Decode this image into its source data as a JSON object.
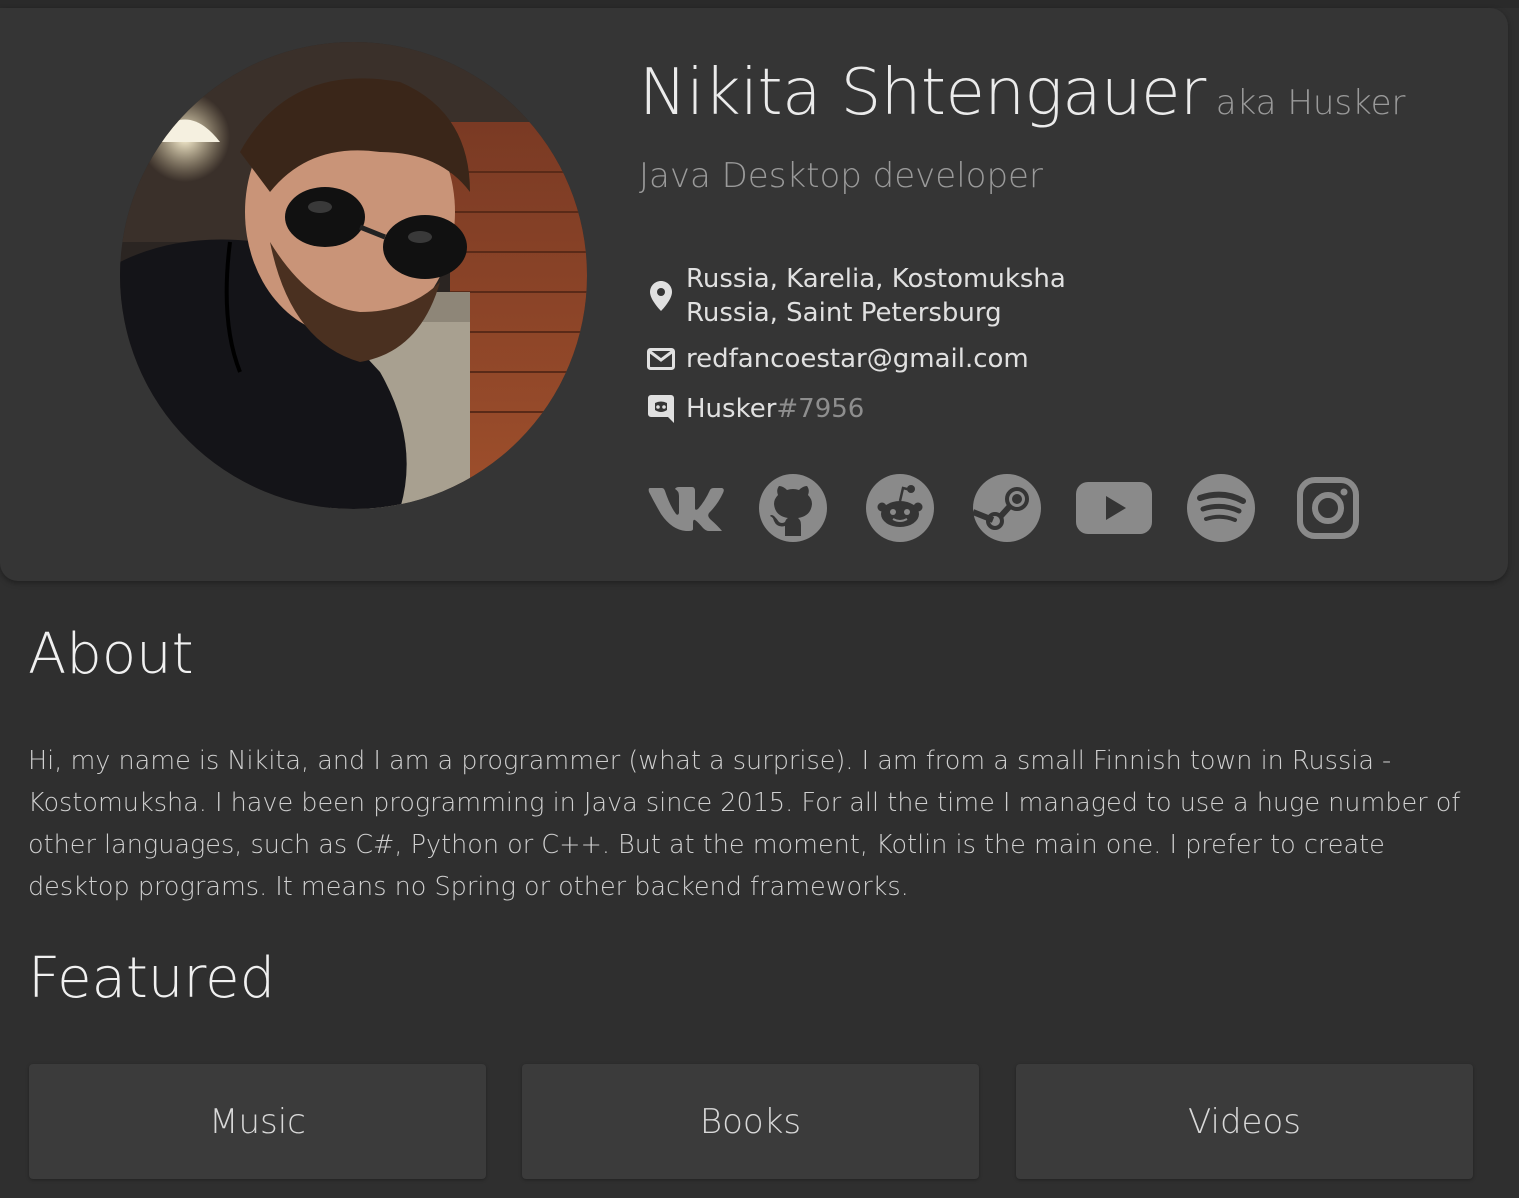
{
  "profile": {
    "name": "Nikita Shtengauer",
    "aka": "aka Husker",
    "role": "Java Desktop developer",
    "locations": [
      "Russia, Karelia, Kostomuksha",
      "Russia, Saint Petersburg"
    ],
    "email": "redfancoestar@gmail.com",
    "discord_user": "Husker",
    "discord_tag": "#7956",
    "socials": [
      "vk-icon",
      "github-icon",
      "reddit-icon",
      "steam-icon",
      "youtube-icon",
      "spotify-icon",
      "instagram-icon"
    ]
  },
  "about": {
    "title": "About",
    "text": "Hi, my name is Nikita, and I am a programmer (what a surprise). I am from a small Finnish town in Russia - Kostomuksha. I have been programming in Java since 2015. For all the time I managed to use a huge number of other languages, such as C#, Python or C++. But at the moment, Kotlin is the main one. I prefer to create desktop programs. It means no Spring or other backend frameworks."
  },
  "featured": {
    "title": "Featured",
    "items": [
      "Music",
      "Books",
      "Videos"
    ]
  },
  "colors": {
    "background": "#2f2f2f",
    "card": "#353535",
    "icon": "#8a8a8a"
  }
}
